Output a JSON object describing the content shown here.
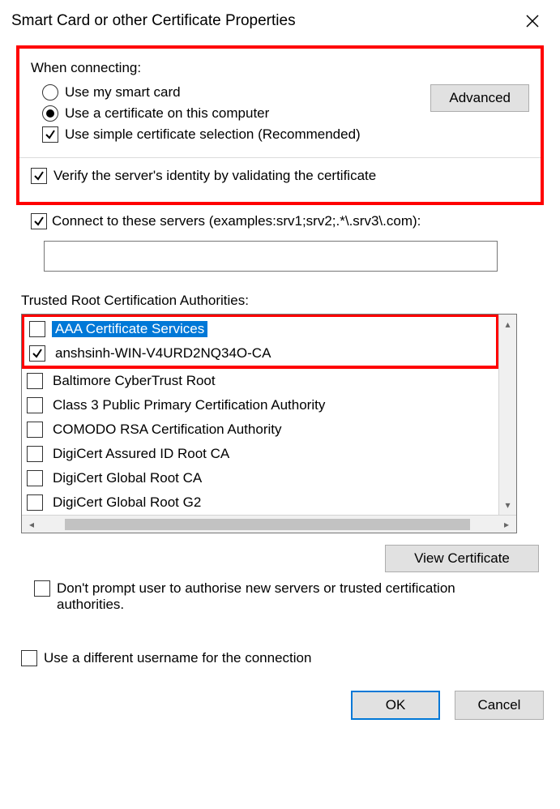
{
  "titlebar": {
    "title": "Smart Card or other Certificate Properties"
  },
  "whenConnecting": {
    "label": "When connecting:",
    "useSmartCard": "Use my smart card",
    "useCertOnComputer": "Use a certificate on this computer",
    "simpleSelection": "Use simple certificate selection (Recommended)",
    "advanced": "Advanced"
  },
  "verifyServer": "Verify the server's identity by validating the certificate",
  "connectServers": "Connect to these servers (examples:srv1;srv2;.*\\.srv3\\.com):",
  "serversValue": "",
  "trustedRootLabel": "Trusted Root Certification Authorities:",
  "caList": [
    {
      "label": "AAA Certificate Services",
      "checked": false,
      "selected": true
    },
    {
      "label": "anshsinh-WIN-V4URD2NQ34O-CA",
      "checked": true,
      "selected": false
    },
    {
      "label": "Baltimore CyberTrust Root",
      "checked": false,
      "selected": false
    },
    {
      "label": "Class 3 Public Primary Certification Authority",
      "checked": false,
      "selected": false
    },
    {
      "label": "COMODO RSA Certification Authority",
      "checked": false,
      "selected": false
    },
    {
      "label": "DigiCert Assured ID Root CA",
      "checked": false,
      "selected": false
    },
    {
      "label": "DigiCert Global Root CA",
      "checked": false,
      "selected": false
    },
    {
      "label": "DigiCert Global Root G2",
      "checked": false,
      "selected": false
    }
  ],
  "viewCertificate": "View Certificate",
  "dontPrompt": "Don't prompt user to authorise new servers or trusted certification authorities.",
  "useDiffUser": "Use a different username for the connection",
  "buttons": {
    "ok": "OK",
    "cancel": "Cancel"
  }
}
